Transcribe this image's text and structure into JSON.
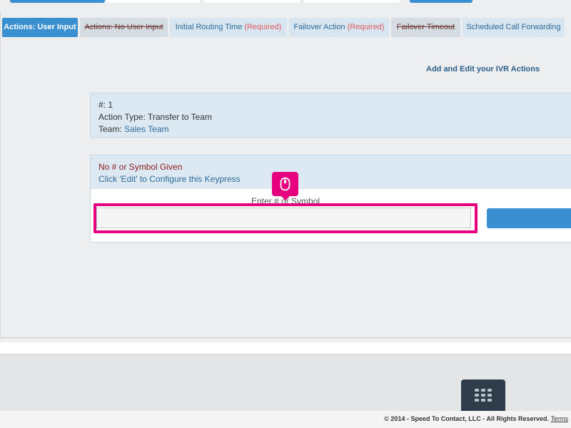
{
  "tabs": [
    {
      "label": "Actions: User Input",
      "required": "",
      "state": "active"
    },
    {
      "label": "Actions: No User Input",
      "required": "",
      "state": "disabled"
    },
    {
      "label": "Initial Routing Time",
      "required": "(Required)",
      "state": "normal"
    },
    {
      "label": "Failover Action",
      "required": "(Required)",
      "state": "normal"
    },
    {
      "label": "Failover Timeout",
      "required": "",
      "state": "disabled"
    },
    {
      "label": "Scheduled Call Forwarding",
      "required": "",
      "state": "normal"
    }
  ],
  "ivr_link": "Add and Edit your IVR Actions",
  "action": {
    "number_line": "#: 1",
    "type_line": "Action Type: Transfer to Team",
    "team_prefix": "Team: ",
    "team_value": "Sales Team"
  },
  "keypress": {
    "title": "No # or Symbol Given",
    "hint": "Click 'Edit' to Configure this Keypress",
    "input_label": "Enter # or Symbol",
    "input_value": "",
    "input_placeholder": ""
  },
  "footer": {
    "copyright": "© 2014 - Speed To Contact, LLC - All Rights Reserved.",
    "terms": "Terms"
  },
  "icons": {
    "cursor_badge": "mouse-icon",
    "keypad": "keypad-grid-icon"
  },
  "colors": {
    "accent": "#3a8fd0",
    "highlight": "#e6007e",
    "tab_bg": "#d7e6f0",
    "panel_bg": "#dce9f2",
    "required": "#e05a5a",
    "title_red": "#8b1a1a"
  }
}
